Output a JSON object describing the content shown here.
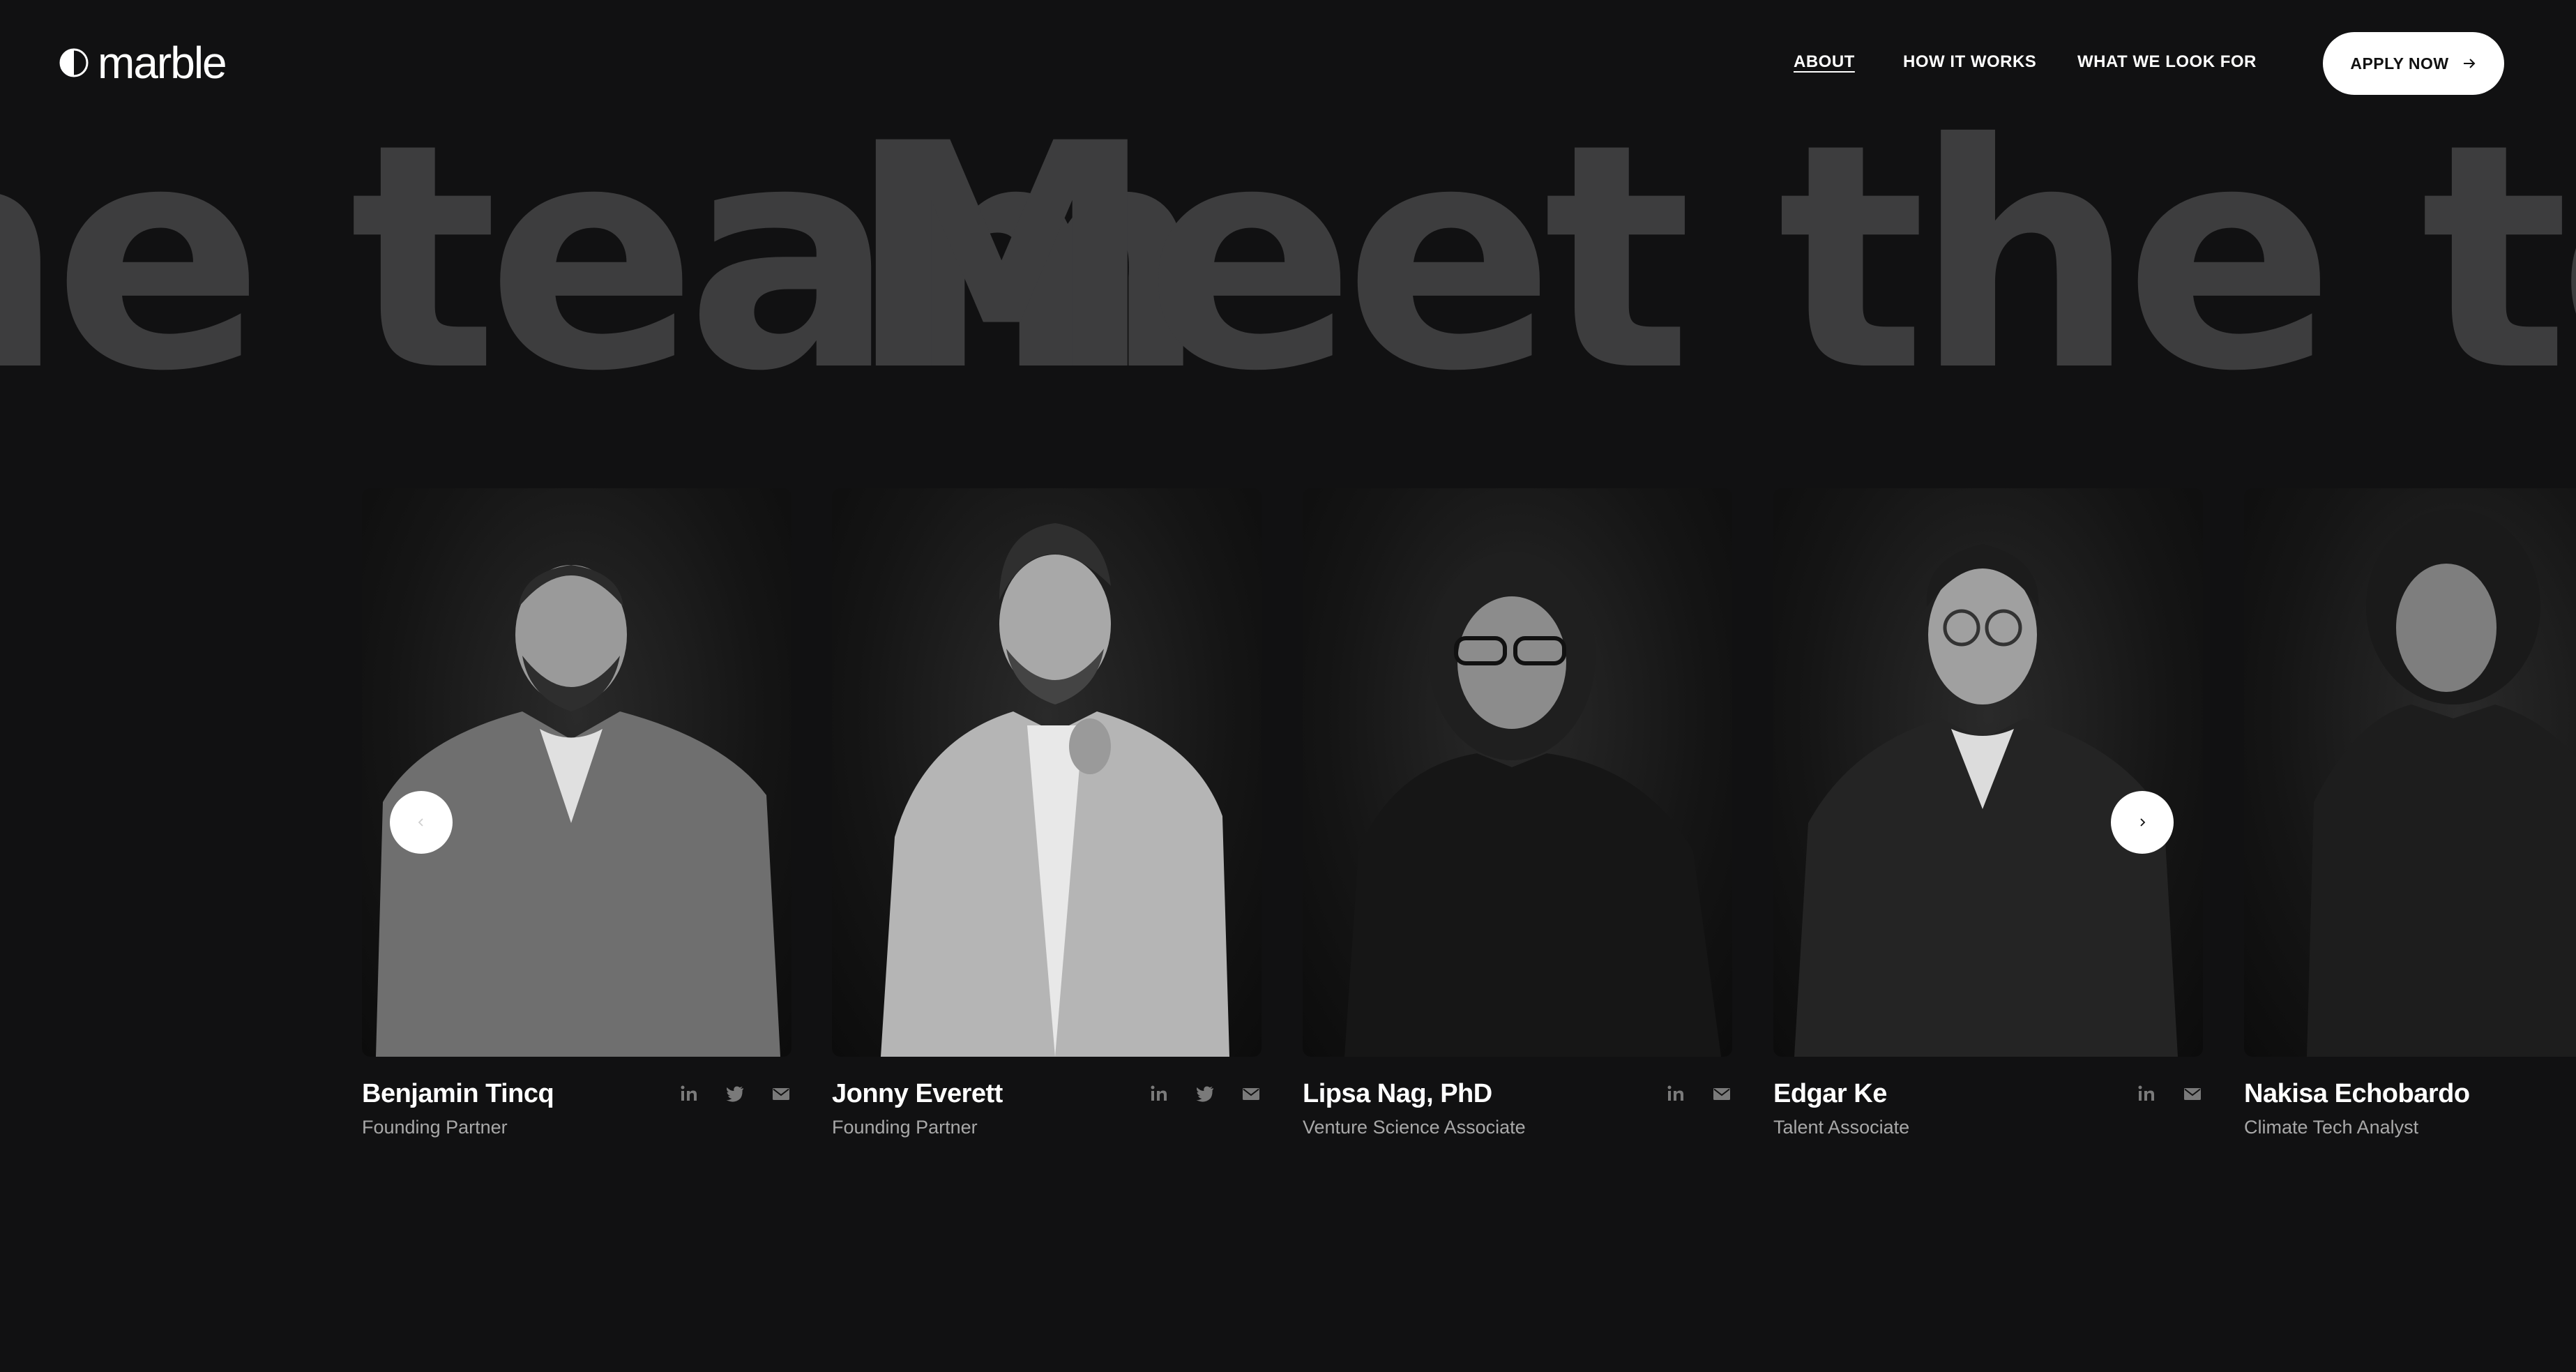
{
  "brand": {
    "name": "marble"
  },
  "nav": {
    "items": [
      {
        "label": "ABOUT",
        "active": true
      },
      {
        "label": "HOW IT WORKS",
        "active": false
      },
      {
        "label": "WHAT WE LOOK FOR",
        "active": false
      }
    ],
    "cta_label": "APPLY NOW",
    "cta_icon": "arrow-right-icon"
  },
  "hero": {
    "marquee_text": "Meet the team"
  },
  "carousel": {
    "prev_icon": "chevron-left-icon",
    "next_icon": "chevron-right-icon"
  },
  "team": [
    {
      "name": "Benjamin Tincq",
      "role": "Founding Partner",
      "socials": [
        "linkedin-icon",
        "twitter-icon",
        "email-icon"
      ]
    },
    {
      "name": "Jonny Everett",
      "role": "Founding Partner",
      "socials": [
        "linkedin-icon",
        "twitter-icon",
        "email-icon"
      ]
    },
    {
      "name": "Lipsa Nag, PhD",
      "role": "Venture Science Associate",
      "socials": [
        "linkedin-icon",
        "email-icon"
      ]
    },
    {
      "name": "Edgar Ke",
      "role": "Talent Associate",
      "socials": [
        "linkedin-icon",
        "email-icon"
      ]
    },
    {
      "name": "Nakisa Echobardo",
      "role": "Climate Tech Analyst",
      "socials": []
    }
  ],
  "colors": {
    "background": "#111112",
    "marquee_text": "#3d3d3e",
    "role_text": "#a8a8a8",
    "icon": "#7a7a7a"
  }
}
